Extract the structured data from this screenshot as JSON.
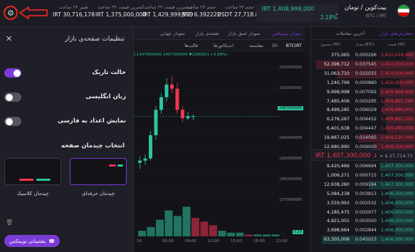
{
  "header": {
    "market_name": "بیت‌کوین / تومان",
    "market_pair": "BTC / IRT",
    "last_price": "IRT 1,408,999,000",
    "change_pct": "2.18%",
    "stats": [
      {
        "label": "تغییر ۲۴ ساعت",
        "value": "IRT 30,716,178"
      },
      {
        "label": "کمترین قیمت ۲۴ ساعت",
        "value": "IRT 1,375,000,000"
      },
      {
        "label": "بیشترین قیمت ۲۴ ساعت",
        "value": "IRT 1,429,999,999"
      },
      {
        "label": "حجم ۲۴ ساعت",
        "value": "BTC 6.392222"
      },
      {
        "label": "حجم ۲۴ ساعت",
        "value": "USDT 27,718.85"
      }
    ],
    "gear_icon": "gear-icon"
  },
  "settings": {
    "title": "تنظیمات صفحه‌ی بازار",
    "items": [
      {
        "label": "حالت تاریک",
        "on": true
      },
      {
        "label": "زبان انگلیسی",
        "on": false
      },
      {
        "label": "نمایش اعداد به فارسی",
        "on": false
      }
    ],
    "layout_title": "انتخاب چیدمان صفحه",
    "layouts": [
      {
        "label": "چیدمان حرفه‌ای",
        "active": true
      },
      {
        "label": "چیدمان کلاسیک",
        "active": false
      }
    ],
    "support_label": "پشتیبانی نوبیتکس"
  },
  "chart": {
    "tabs": [
      "نمودار نوبیتکس",
      "نمودار عمق بازار",
      "نقشه‌ی بازار",
      "نمودار جهانی"
    ],
    "active_tab": 0,
    "tools": [
      "1h",
      "مقایسه",
      "اندیکاتورها",
      "قالب‌ها"
    ],
    "symbol": "BTCIRT",
    "ohlc": "C1407000000 1407300000 ▼1300001 (-0.09%)",
    "current_price_tag": "1407000000",
    "volume_tag": "0.23",
    "y_axis": [
      "1430000000",
      "1420000000",
      "1410000000",
      "1400000000",
      "1390000000",
      "1380000000",
      "1370000000"
    ],
    "x_axis": [
      "16",
      "06:00",
      "09:00",
      "12:00",
      "15:00",
      "18:00",
      "21:00"
    ]
  },
  "chart_data": {
    "type": "candlestick",
    "y_range": [
      1365000000,
      1433000000
    ],
    "candles": [
      {
        "o": 1385000000,
        "h": 1388000000,
        "l": 1382000000,
        "c": 1386000000,
        "dir": "up"
      },
      {
        "o": 1386000000,
        "h": 1389000000,
        "l": 1384000000,
        "c": 1387000000,
        "dir": "up"
      },
      {
        "o": 1387000000,
        "h": 1400000000,
        "l": 1386000000,
        "c": 1398000000,
        "dir": "up"
      },
      {
        "o": 1398000000,
        "h": 1412000000,
        "l": 1396000000,
        "c": 1410000000,
        "dir": "up"
      },
      {
        "o": 1410000000,
        "h": 1418000000,
        "l": 1408000000,
        "c": 1416000000,
        "dir": "up"
      },
      {
        "o": 1416000000,
        "h": 1425000000,
        "l": 1414000000,
        "c": 1422000000,
        "dir": "up"
      },
      {
        "o": 1422000000,
        "h": 1426000000,
        "l": 1418000000,
        "c": 1420000000,
        "dir": "down"
      },
      {
        "o": 1420000000,
        "h": 1423000000,
        "l": 1408000000,
        "c": 1410000000,
        "dir": "down"
      },
      {
        "o": 1410000000,
        "h": 1412000000,
        "l": 1404000000,
        "c": 1406000000,
        "dir": "down"
      },
      {
        "o": 1406000000,
        "h": 1409000000,
        "l": 1405000000,
        "c": 1407000000,
        "dir": "up"
      },
      {
        "o": 1407000000,
        "h": 1408000000,
        "l": 1405000000,
        "c": 1407000000,
        "dir": "up"
      }
    ],
    "volumes": [
      3,
      5,
      9,
      14,
      11,
      16,
      10,
      8,
      6,
      3,
      2,
      2,
      1,
      1,
      1,
      1
    ],
    "volume_colors": [
      "up",
      "up",
      "up",
      "up",
      "up",
      "up",
      "down",
      "down",
      "down",
      "up",
      "up",
      "up",
      "down",
      "up",
      "up",
      "up"
    ]
  },
  "orderbook": {
    "tabs": [
      "سفارش‌های بازار",
      "آخرین معاملات"
    ],
    "headers": [
      "مجموع (IRT)",
      "مقدار (BTC)",
      "قیمت (IRT)"
    ],
    "asks": [
      {
        "total": "375,065",
        "amount": "0.000266",
        "price": "1,410,018,900"
      },
      {
        "total": "52,398,712",
        "amount": "0.037545",
        "price": "1,410,000,000"
      },
      {
        "total": "31,063,710",
        "amount": "0.022031",
        "price": "1,410,000,000"
      },
      {
        "total": "1,240,799",
        "amount": "0.000880",
        "price": "1,410,000,000"
      },
      {
        "total": "9,998,998",
        "amount": "0.007092",
        "price": "1,409,899,999"
      },
      {
        "total": "7,465,406",
        "amount": "0.005295",
        "price": "1,409,897,289"
      },
      {
        "total": "8,499,285",
        "amount": "0.006029",
        "price": "1,409,886,000"
      },
      {
        "total": "6,276,267",
        "amount": "0.004452",
        "price": "1,409,867,050"
      },
      {
        "total": "6,401,638",
        "amount": "0.004447",
        "price": "1,409,489,999"
      },
      {
        "total": "19,867,025",
        "amount": "0.014095",
        "price": "1,409,520,000"
      },
      {
        "total": "12,680,990",
        "amount": "0.009000",
        "price": "1,409,000,000"
      }
    ],
    "mid_price": "IRT 1,407,300,000 ↓",
    "mid_ref": "≈ $ 27,714.75",
    "bids": [
      {
        "total": "9,420,466",
        "amount": "0.006694",
        "price": "1,407,300,000"
      },
      {
        "total": "1,006,271",
        "amount": "0.000715",
        "price": "1,407,300,000"
      },
      {
        "total": "12,938,280",
        "amount": "0.009194",
        "price": "1,407,300,000"
      },
      {
        "total": "5,084,238",
        "amount": "0.003813",
        "price": "1,406,000,000"
      },
      {
        "total": "3,559,993",
        "amount": "0.002532",
        "price": "1,406,000,000"
      },
      {
        "total": "4,185,475",
        "amount": "0.002977",
        "price": "1,406,000,000"
      },
      {
        "total": "4,921,001",
        "amount": "0.003500",
        "price": "1,406,000,000"
      },
      {
        "total": "3,998,664",
        "amount": "0.002844",
        "price": "1,406,000,000"
      },
      {
        "total": "63,305,006",
        "amount": "0.045023",
        "price": "1,406,000,000"
      }
    ],
    "ask_depth": [
      0.08,
      0.95,
      0.75,
      0.15,
      0.35,
      0.3,
      0.32,
      0.28,
      0.28,
      0.55,
      0.4
    ],
    "bid_depth": [
      0.35,
      0.1,
      0.45,
      0.25,
      0.2,
      0.22,
      0.25,
      0.2,
      0.9
    ]
  },
  "colors": {
    "accent": "#7a3cd6",
    "up": "#2ec4a0",
    "down": "#f0354f"
  }
}
